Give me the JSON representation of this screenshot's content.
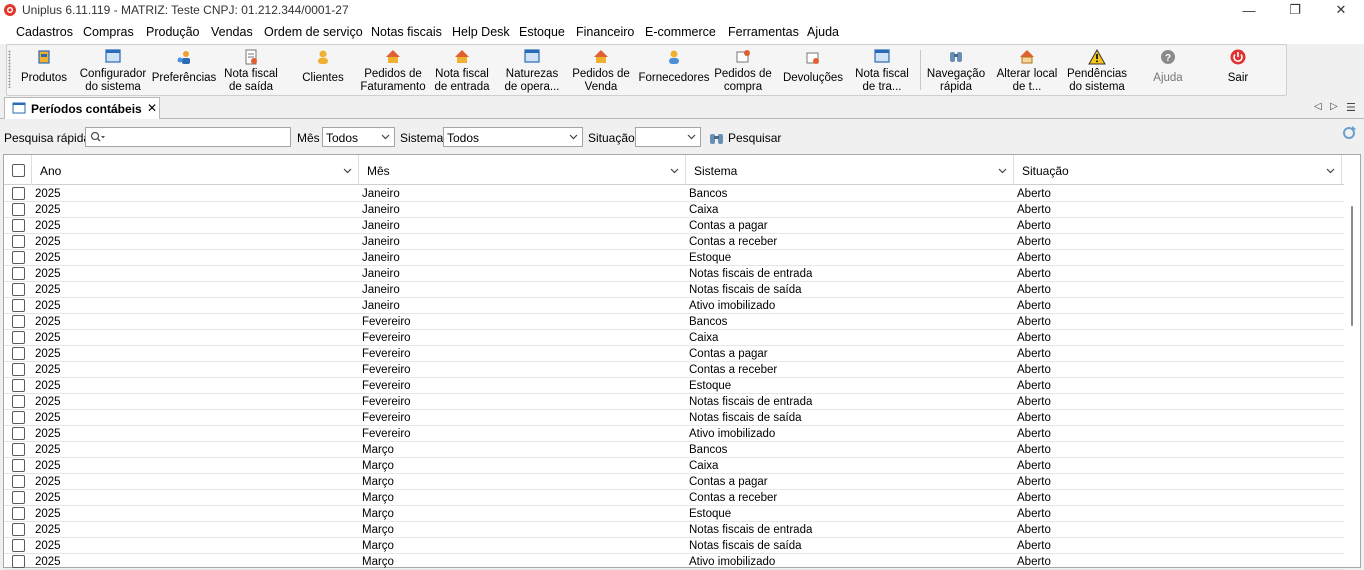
{
  "window": {
    "title": "Uniplus 6.11.119 - MATRIZ: Teste CNPJ: 01.212.344/0001-27",
    "minimize": "—",
    "maximize": "❐",
    "close": "✕"
  },
  "menu": [
    "Cadastros",
    "Compras",
    "Produção",
    "Vendas",
    "Ordem de serviço",
    "Notas fiscais",
    "Help Desk",
    "Estoque",
    "Financeiro",
    "E-commerce",
    "Ferramentas",
    "Ajuda"
  ],
  "toolbar": [
    {
      "label": "Produtos",
      "icon": "box-icon"
    },
    {
      "label": "Configurador\ndo sistema",
      "icon": "window-config-icon"
    },
    {
      "label": "Preferências",
      "icon": "user-settings-icon"
    },
    {
      "label": "Nota fiscal\nde saída",
      "icon": "invoice-out-icon"
    },
    {
      "label": "Clientes",
      "icon": "client-icon"
    },
    {
      "label": "Pedidos de\nFaturamento",
      "icon": "house-order-icon"
    },
    {
      "label": "Nota fiscal\nde entrada",
      "icon": "invoice-in-icon"
    },
    {
      "label": "Naturezas\nde opera...",
      "icon": "window-icon"
    },
    {
      "label": "Pedidos de\nVenda",
      "icon": "house-sale-icon"
    },
    {
      "label": "Fornecedores",
      "icon": "supplier-icon"
    },
    {
      "label": "Pedidos de\ncompra",
      "icon": "purchase-icon"
    },
    {
      "label": "Devoluções",
      "icon": "return-icon"
    },
    {
      "label": "Nota fiscal\nde tra...",
      "icon": "window-transfer-icon"
    },
    {
      "label": "Navegação\nrápida",
      "icon": "binoculars-icon"
    },
    {
      "label": "Alterar local\nde t...",
      "icon": "home-icon"
    },
    {
      "label": "Pendências\ndo sistema",
      "icon": "warning-icon"
    },
    {
      "label": "Ajuda",
      "icon": "help-icon"
    },
    {
      "label": "Sair",
      "icon": "power-icon"
    }
  ],
  "tab": {
    "label": "Períodos contábeis",
    "close": "✕"
  },
  "filters": {
    "search_label": "Pesquisa rápida:",
    "month_label": "Mês",
    "month_value": "Todos",
    "system_label": "Sistema",
    "system_value": "Todos",
    "status_label": "Situação",
    "status_value": "",
    "search_button": "Pesquisar"
  },
  "columns": [
    "Ano",
    "Mês",
    "Sistema",
    "Situação"
  ],
  "rows": [
    [
      "2025",
      "Janeiro",
      "Bancos",
      "Aberto"
    ],
    [
      "2025",
      "Janeiro",
      "Caixa",
      "Aberto"
    ],
    [
      "2025",
      "Janeiro",
      "Contas a pagar",
      "Aberto"
    ],
    [
      "2025",
      "Janeiro",
      "Contas a receber",
      "Aberto"
    ],
    [
      "2025",
      "Janeiro",
      "Estoque",
      "Aberto"
    ],
    [
      "2025",
      "Janeiro",
      "Notas fiscais de entrada",
      "Aberto"
    ],
    [
      "2025",
      "Janeiro",
      "Notas fiscais de saída",
      "Aberto"
    ],
    [
      "2025",
      "Janeiro",
      "Ativo imobilizado",
      "Aberto"
    ],
    [
      "2025",
      "Fevereiro",
      "Bancos",
      "Aberto"
    ],
    [
      "2025",
      "Fevereiro",
      "Caixa",
      "Aberto"
    ],
    [
      "2025",
      "Fevereiro",
      "Contas a pagar",
      "Aberto"
    ],
    [
      "2025",
      "Fevereiro",
      "Contas a receber",
      "Aberto"
    ],
    [
      "2025",
      "Fevereiro",
      "Estoque",
      "Aberto"
    ],
    [
      "2025",
      "Fevereiro",
      "Notas fiscais de entrada",
      "Aberto"
    ],
    [
      "2025",
      "Fevereiro",
      "Notas fiscais de saída",
      "Aberto"
    ],
    [
      "2025",
      "Fevereiro",
      "Ativo imobilizado",
      "Aberto"
    ],
    [
      "2025",
      "Março",
      "Bancos",
      "Aberto"
    ],
    [
      "2025",
      "Março",
      "Caixa",
      "Aberto"
    ],
    [
      "2025",
      "Março",
      "Contas a pagar",
      "Aberto"
    ],
    [
      "2025",
      "Março",
      "Contas a receber",
      "Aberto"
    ],
    [
      "2025",
      "Março",
      "Estoque",
      "Aberto"
    ],
    [
      "2025",
      "Março",
      "Notas fiscais de entrada",
      "Aberto"
    ],
    [
      "2025",
      "Março",
      "Notas fiscais de saída",
      "Aberto"
    ],
    [
      "2025",
      "Março",
      "Ativo imobilizado",
      "Aberto"
    ]
  ]
}
